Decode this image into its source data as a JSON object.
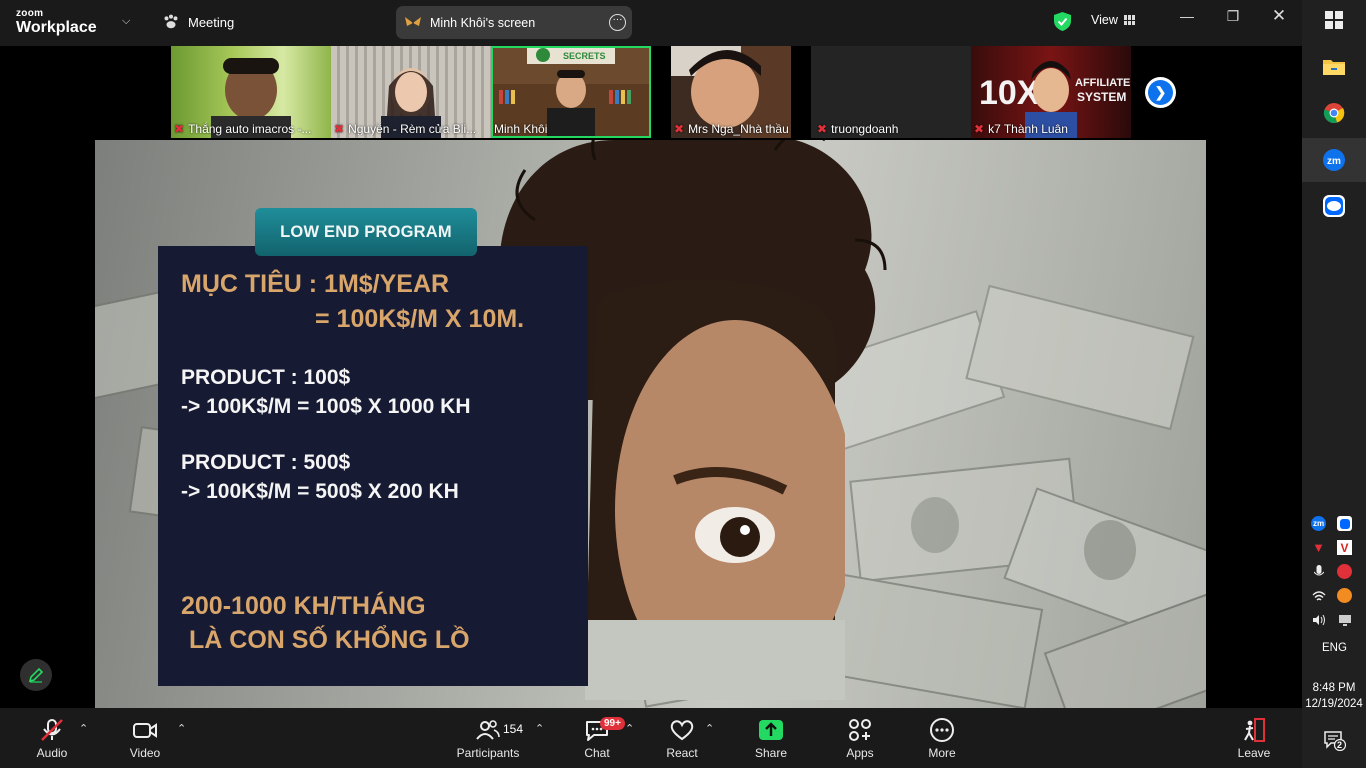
{
  "brand": {
    "line1": "zoom",
    "line2": "Workplace"
  },
  "meeting": {
    "label": "Meeting"
  },
  "share_pill": {
    "label": "Minh Khôi's screen",
    "more": "···"
  },
  "view": {
    "label": "View"
  },
  "participants_strip": [
    {
      "name": "Thắng auto imacros -...",
      "muted": true
    },
    {
      "name": "Nguyễn - Rèm cửa Bli...",
      "muted": true
    },
    {
      "name": "Minh Khôi",
      "muted": false,
      "active": true
    },
    {
      "name": "Mrs Nga_Nhà thầu th...",
      "muted": true
    },
    {
      "name": "truongdoanh",
      "muted": true
    },
    {
      "name": "k7 Thành Luân",
      "muted": true
    }
  ],
  "tile_signs": {
    "secrets": "SECRETS",
    "tenx": "10X",
    "affiliate": "AFFILIATE",
    "system": "SYSTEM"
  },
  "slide": {
    "tag": "LOW END PROGRAM",
    "goal_line1": "MỤC TIÊU : 1M$/YEAR",
    "goal_line2": "= 100K$/M X 10M.",
    "p1_line1": "PRODUCT : 100$",
    "p1_line2": "-> 100K$/M = 100$ X 1000 KH",
    "p2_line1": "PRODUCT : 500$",
    "p2_line2": "-> 100K$/M = 500$ X 200 KH",
    "footer_line1": "200-1000 KH/THÁNG",
    "footer_line2": "LÀ CON SỐ KHỔNG LỒ"
  },
  "toolbar": {
    "audio": "Audio",
    "video": "Video",
    "participants": "Participants",
    "participants_count": "154",
    "chat": "Chat",
    "chat_badge": "99+",
    "react": "React",
    "share": "Share",
    "apps": "Apps",
    "more": "More",
    "leave": "Leave"
  },
  "taskbar": {
    "language": "ENG",
    "time": "8:48 PM",
    "date": "12/19/2024",
    "notifications": "2",
    "tray_zoom": "zm"
  },
  "colors": {
    "active_border": "#23d962",
    "share_green": "#23d962",
    "mute_red": "#e0303a",
    "zoom_blue": "#0e72ed",
    "slide_gold": "#d8a56a",
    "slide_box": "#171a33"
  }
}
